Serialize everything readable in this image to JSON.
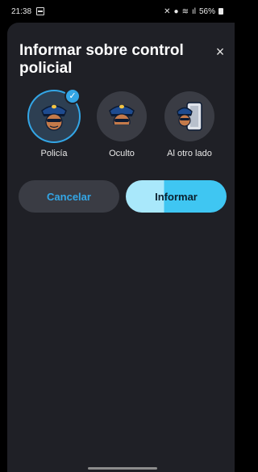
{
  "status_bar": {
    "time": "21:38",
    "right_text": "56%",
    "icons": [
      "gallery-notification-icon",
      "mute-icon",
      "location-icon",
      "wifi-icon",
      "signal-icon",
      "battery-icon"
    ]
  },
  "dialog": {
    "title": "Informar sobre control policial",
    "close_label": "×",
    "options": [
      {
        "label": "Policía",
        "selected": true,
        "icon": "police-officer-icon"
      },
      {
        "label": "Oculto",
        "selected": false,
        "icon": "hidden-police-icon"
      },
      {
        "label": "Al otro lado",
        "selected": false,
        "icon": "police-other-side-icon"
      }
    ],
    "cancel_label": "Cancelar",
    "report_label": "Informar"
  },
  "colors": {
    "accent": "#33a6e6",
    "sheet_bg": "#1f2026",
    "button_bg": "#3a3c44"
  }
}
